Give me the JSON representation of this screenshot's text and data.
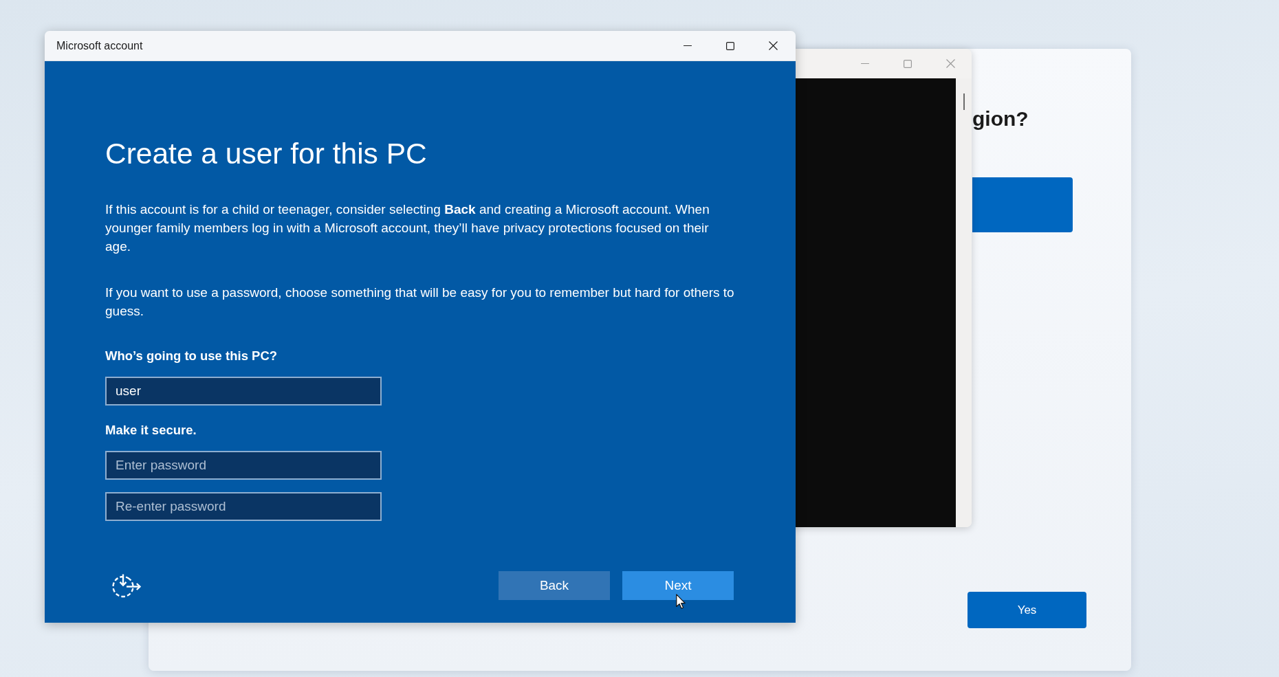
{
  "window": {
    "title": "Microsoft account"
  },
  "page": {
    "heading": "Create a user for this PC",
    "paragraphs": [
      "If this account is for a child or teenager, consider selecting **Back** and creating a Microsoft account. When younger family members log in with a Microsoft account, they’ll have privacy protections focused on their age.",
      "If you want to use a password, choose something that will be easy for you to remember but hard for others to guess."
    ],
    "sections": [
      {
        "label": "Who’s going to use this PC?",
        "fields": [
          {
            "kind": "text",
            "value": "user"
          }
        ]
      },
      {
        "label": "Make it secure.",
        "fields": [
          {
            "kind": "password",
            "placeholder": "Enter password"
          },
          {
            "kind": "password",
            "placeholder": "Re-enter password"
          }
        ]
      }
    ],
    "buttons": [
      {
        "label": "Back",
        "hovered": false
      },
      {
        "label": "Next",
        "hovered": true
      }
    ]
  },
  "setup_window": {
    "heading": "gion?",
    "list": [
      {
        "selected": true
      }
    ],
    "buttons": [
      {
        "label": "Yes"
      }
    ]
  }
}
